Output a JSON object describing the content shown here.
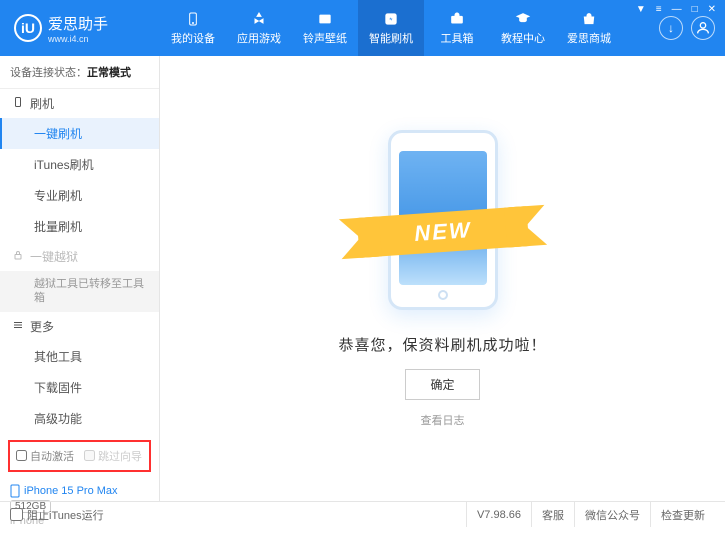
{
  "app": {
    "name": "爱思助手",
    "site": "www.i4.cn",
    "logo_letter": "iU"
  },
  "window_controls": {
    "settings": "≡",
    "min": "—",
    "max": "□",
    "close": "✕",
    "gift": "▼"
  },
  "nav": [
    {
      "icon": "device",
      "label": "我的设备"
    },
    {
      "icon": "apps",
      "label": "应用游戏"
    },
    {
      "icon": "ringtone",
      "label": "铃声壁纸"
    },
    {
      "icon": "flash",
      "label": "智能刷机",
      "active": true
    },
    {
      "icon": "toolbox",
      "label": "工具箱"
    },
    {
      "icon": "tutorial",
      "label": "教程中心"
    },
    {
      "icon": "store",
      "label": "爱思商城"
    }
  ],
  "header_right": {
    "download": "↓",
    "user": "👤"
  },
  "sidebar": {
    "status_label": "设备连接状态：",
    "status_value": "正常模式",
    "groups": [
      {
        "title": "刷机",
        "icon": "phone",
        "items": [
          {
            "label": "一键刷机",
            "active": true
          },
          {
            "label": "iTunes刷机"
          },
          {
            "label": "专业刷机"
          },
          {
            "label": "批量刷机"
          }
        ]
      },
      {
        "title": "一键越狱",
        "icon": "lock",
        "locked": true,
        "items": [
          {
            "label": "越狱工具已转移至工具箱",
            "gray": true
          }
        ]
      },
      {
        "title": "更多",
        "icon": "more",
        "items": [
          {
            "label": "其他工具"
          },
          {
            "label": "下载固件"
          },
          {
            "label": "高级功能"
          }
        ]
      }
    ],
    "checks": {
      "auto_activate": "自动激活",
      "skip_guide": "跳过向导"
    },
    "device": {
      "name": "iPhone 15 Pro Max",
      "storage": "512GB",
      "model": "iPhone"
    }
  },
  "main": {
    "banner": "NEW",
    "success": "恭喜您，保资料刷机成功啦！",
    "confirm": "确定",
    "log_link": "查看日志"
  },
  "footer": {
    "block_itunes": "阻止iTunes运行",
    "version": "V7.98.66",
    "links": [
      "客服",
      "微信公众号",
      "检查更新"
    ]
  }
}
